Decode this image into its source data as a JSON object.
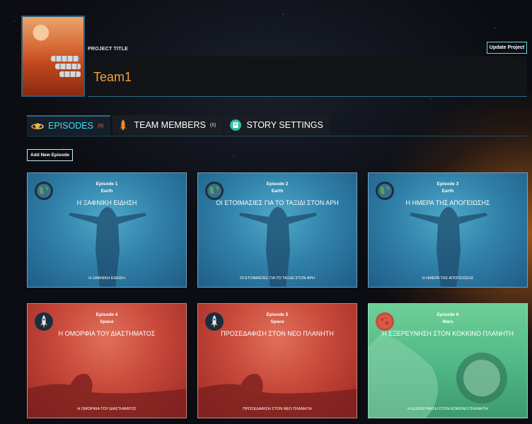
{
  "header": {
    "project_label": "PROJECT TITLE",
    "project_title": "Team1",
    "update_button": "Update Project"
  },
  "tabs": [
    {
      "label": "EPISODES",
      "count": "(6)",
      "icon": "planet-icon",
      "active": true
    },
    {
      "label": "TEAM MEMBERS",
      "count": "(6)",
      "icon": "rocket-icon",
      "active": false
    },
    {
      "label": "STORY SETTINGS",
      "count": "",
      "icon": "book-icon",
      "active": false
    }
  ],
  "add_episode_button": "Add New Episode",
  "episodes": [
    {
      "number": "Episode 1",
      "category": "Earth",
      "title": "Η ΞΑΦΝΙΚΗ ΕΙΔΗΣΗ",
      "footer": "Η ΞΑΦΝΙΚΗ ΕΙΔΗΣΗ",
      "icon": "earth-icon"
    },
    {
      "number": "Episode 2",
      "category": "Earth",
      "title": "ΟΙ ΕΤΟΙΜΑΣΙΕΣ ΓΙΑ ΤΟ ΤΑΞΙΔΙ ΣΤΟΝ ΑΡΗ",
      "footer": "ΟΙ ΕΤΟΙΜΑΣΙΕΣ ΓΙΑ ΤΟ ΤΑΞΙΔΙ ΣΤΟΝ ΑΡΗ",
      "icon": "earth-icon"
    },
    {
      "number": "Episode 3",
      "category": "Earth",
      "title": "Η ΗΜΕΡΑ ΤΗΣ ΑΠΟΓΕΙΩΣΗΣ",
      "footer": "Η ΗΜΕΡΑ ΤΗΣ ΑΠΟΓΕΙΩΣΗΣ",
      "icon": "earth-icon"
    },
    {
      "number": "Episode 4",
      "category": "Space",
      "title": "Η ΟΜΟΡΦΙΑ ΤΟΥ ΔΙΑΣΤΗΜΑΤΟΣ",
      "footer": "Η ΟΜΟΡΦΙΑ ΤΟΥ ΔΙΑΣΤΗΜΑΤΟΣ",
      "icon": "rocket-icon"
    },
    {
      "number": "Episode 5",
      "category": "Space",
      "title": "ΠΡΟΣΕΔΑΦΙΣΗ ΣΤΟΝ ΝΕΟ ΠΛΑΝΗΤΗ",
      "footer": "ΠΡΟΣΕΔΑΦΙΣΗ ΣΤΟΝ ΝΕΟ ΠΛΑΝΗΤΗ",
      "icon": "rocket-icon"
    },
    {
      "number": "Episode 6",
      "category": "Mars",
      "title": "Η ΕΞΕΡΕΥΝΗΣΗ ΣΤΟΝ ΚΟΚΚΙΝΟ ΠΛΑΝΗΤΗ",
      "footer": "Η ΕΞΕΡΕΥΝΗΣΗ ΣΤΟΝ ΚΟΚΚΙΝΟ ΠΛΑΝΗΤΗ",
      "icon": "mars-icon"
    }
  ],
  "colors": {
    "accent_cyan": "#3fe0f2",
    "title_orange": "#f3a23a",
    "earth_card": "#2f7fa8",
    "space_card": "#c8493a",
    "mars_card": "#52b987"
  }
}
